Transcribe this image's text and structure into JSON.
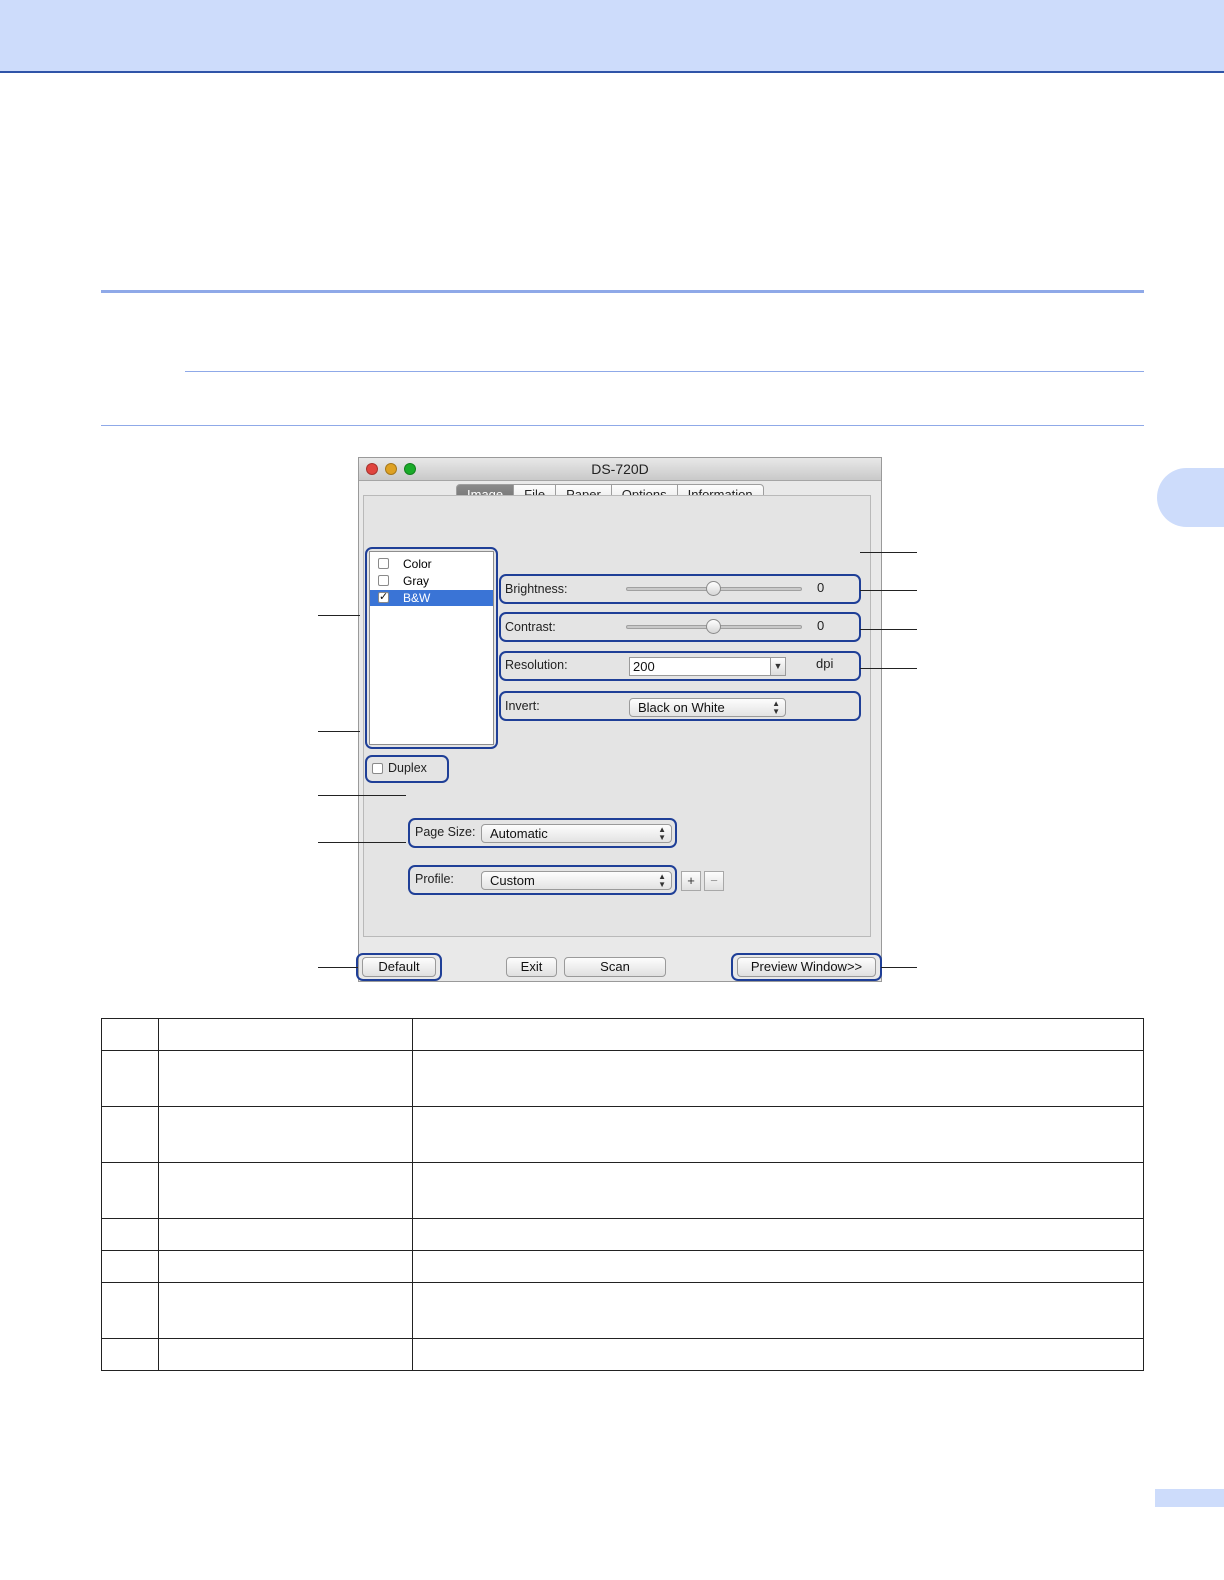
{
  "dialog": {
    "title": "DS-720D",
    "tabs": [
      "Image",
      "File",
      "Paper",
      "Options",
      "Information"
    ],
    "image_types": [
      {
        "label": "Color",
        "checked": false,
        "selected": false
      },
      {
        "label": "Gray",
        "checked": false,
        "selected": false
      },
      {
        "label": "B&W",
        "checked": true,
        "selected": true
      }
    ],
    "brightness": {
      "label": "Brightness:",
      "value": "0",
      "position": 0.5
    },
    "contrast": {
      "label": "Contrast:",
      "value": "0",
      "position": 0.5
    },
    "resolution": {
      "label": "Resolution:",
      "value": "200",
      "unit": "dpi"
    },
    "invert": {
      "label": "Invert:",
      "value": "Black on White"
    },
    "duplex": {
      "label": "Duplex",
      "checked": false
    },
    "page_size": {
      "label": "Page Size:",
      "value": "Automatic"
    },
    "profile": {
      "label": "Profile:",
      "value": "Custom",
      "add": "+",
      "remove": "−"
    },
    "buttons": {
      "default": "Default",
      "exit": "Exit",
      "scan": "Scan",
      "preview": "Preview Window>>"
    }
  },
  "colors": {
    "accent": "#cddcfb",
    "highlight_border": "#1f3f97",
    "rule": "#8fa9e8",
    "selection": "#3a74d6"
  },
  "table": {
    "rows": 8,
    "columns": 3
  }
}
